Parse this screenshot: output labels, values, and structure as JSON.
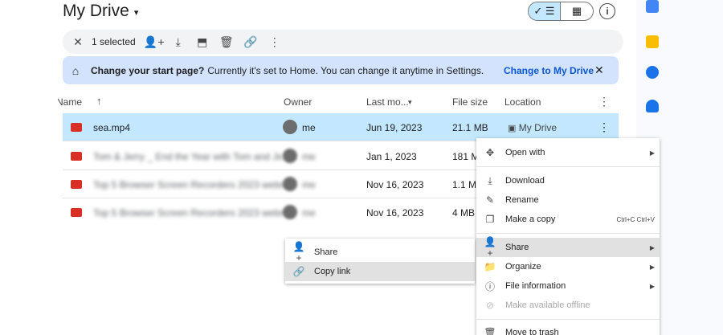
{
  "header": {
    "title": "My Drive",
    "caret": "▾"
  },
  "view_toggle": {
    "list_icon": "✓ ☰",
    "grid_icon": "▦"
  },
  "info_icon": "i",
  "selection_bar": {
    "close_icon": "✕",
    "count_label": "1 selected",
    "icons": [
      "👤+",
      "⤓",
      "⬒",
      "🗑",
      "🔗",
      "⋮"
    ]
  },
  "banner": {
    "home_icon": "⌂",
    "bold_text": "Change your start page?",
    "text": "Currently it's set to Home. You can change it anytime in Settings.",
    "link": "Change to My Drive",
    "close_icon": "✕"
  },
  "table": {
    "columns": {
      "name": "Name",
      "sort_icon": "↑",
      "owner": "Owner",
      "modified": "Last mo...",
      "modified_caret": "▾",
      "size": "File size",
      "location": "Location",
      "more": "⋮"
    },
    "rows": [
      {
        "name": "sea.mp4",
        "owner": "me",
        "modified": "Jun 19, 2023",
        "size": "21.1 MB",
        "location": "My Drive",
        "more": "⋮"
      },
      {
        "name": "Tom & Jerry _ End the Year with Tom and Je...",
        "owner": "me",
        "modified": "Jan 1, 2023",
        "size": "181 MB",
        "location": "",
        "more": ""
      },
      {
        "name": "Top 5 Browser Screen Recorders 2023 webm",
        "owner": "me",
        "modified": "Nov 16, 2023",
        "size": "1.1 MB",
        "location": "",
        "more": ""
      },
      {
        "name": "Top 5 Browser Screen Recorders 2023 webm",
        "owner": "me",
        "modified": "Nov 16, 2023",
        "size": "4 MB",
        "location": "",
        "more": ""
      }
    ]
  },
  "share_submenu": {
    "items": [
      {
        "icon": "👤+",
        "label": "Share"
      },
      {
        "icon": "🔗",
        "label": "Copy link"
      }
    ]
  },
  "context_menu": {
    "open_with": "Open with",
    "download": "Download",
    "rename": "Rename",
    "make_copy": "Make a copy",
    "make_copy_shortcut": "Ctrl+C Ctrl+V",
    "share": "Share",
    "organize": "Organize",
    "file_information": "File information",
    "offline": "Make available offline",
    "trash": "Move to trash",
    "arrow": "▶",
    "icons": {
      "open_with": "✥",
      "download": "⤓",
      "rename": "✎",
      "make_copy": "❐",
      "share": "👤+",
      "organize": "📁",
      "file_information": "ⓘ",
      "offline": "⊘",
      "trash": "🗑"
    }
  },
  "colors": {
    "selected_row": "#c2e7ff",
    "banner": "#d3e3fd",
    "link": "#0b57d0",
    "file_icon": "#d93025"
  }
}
